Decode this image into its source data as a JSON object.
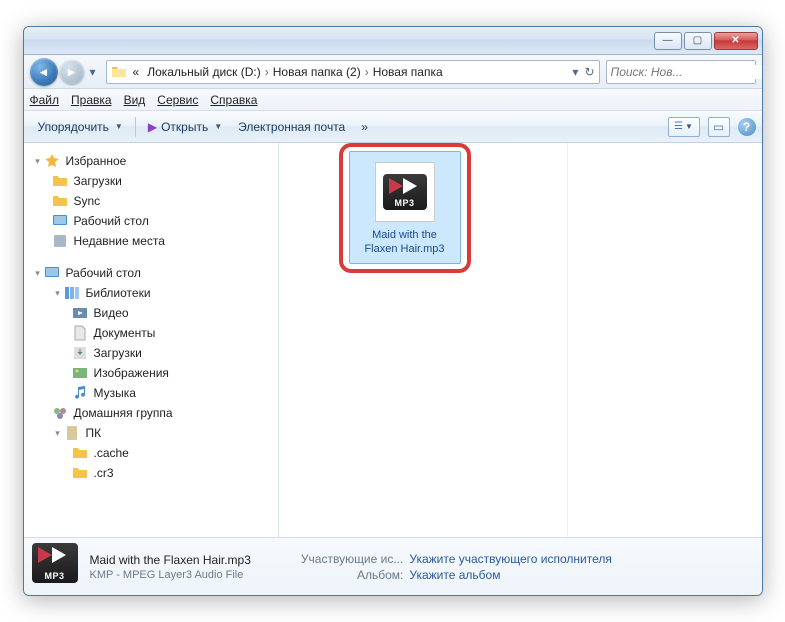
{
  "titlebar": {
    "min": "—",
    "max": "▢",
    "close": "✕"
  },
  "nav": {
    "back": "◄",
    "fwd": "►",
    "dd": "▾",
    "refresh": "↻",
    "drop": "▾"
  },
  "breadcrumbs": {
    "prefix": "«",
    "items": [
      "Локальный диск (D:)",
      "Новая папка (2)",
      "Новая папка"
    ],
    "sep": "›"
  },
  "search": {
    "placeholder": "Поиск: Нов...",
    "icon": "🔍"
  },
  "menu": {
    "file": "Файл",
    "edit": "Правка",
    "view": "Вид",
    "tools": "Сервис",
    "help": "Справка"
  },
  "toolbar": {
    "organize": "Упорядочить",
    "open": "Открыть",
    "email": "Электронная почта",
    "overflow": "»",
    "view_dd": "▾",
    "preview": "▭",
    "help": "?"
  },
  "tree": {
    "favorites": "Избранное",
    "fav_items": [
      "Загрузки",
      "Sync",
      "Рабочий стол",
      "Недавние места"
    ],
    "desktop": "Рабочий стол",
    "libraries": "Библиотеки",
    "lib_items": [
      "Видео",
      "Документы",
      "Загрузки",
      "Изображения",
      "Музыка"
    ],
    "homegroup": "Домашняя группа",
    "pc": "ПК",
    "pc_items": [
      ".cache",
      ".cr3"
    ]
  },
  "file": {
    "name": "Maid with the Flaxen Hair.mp3",
    "badge": "MP3"
  },
  "details": {
    "name": "Maid with the Flaxen Hair.mp3",
    "type": "KMP - MPEG Layer3 Audio File",
    "artist_lbl": "Участвующие ис...",
    "artist_val": "Укажите участвующего исполнителя",
    "album_lbl": "Альбом:",
    "album_val": "Укажите альбом"
  }
}
